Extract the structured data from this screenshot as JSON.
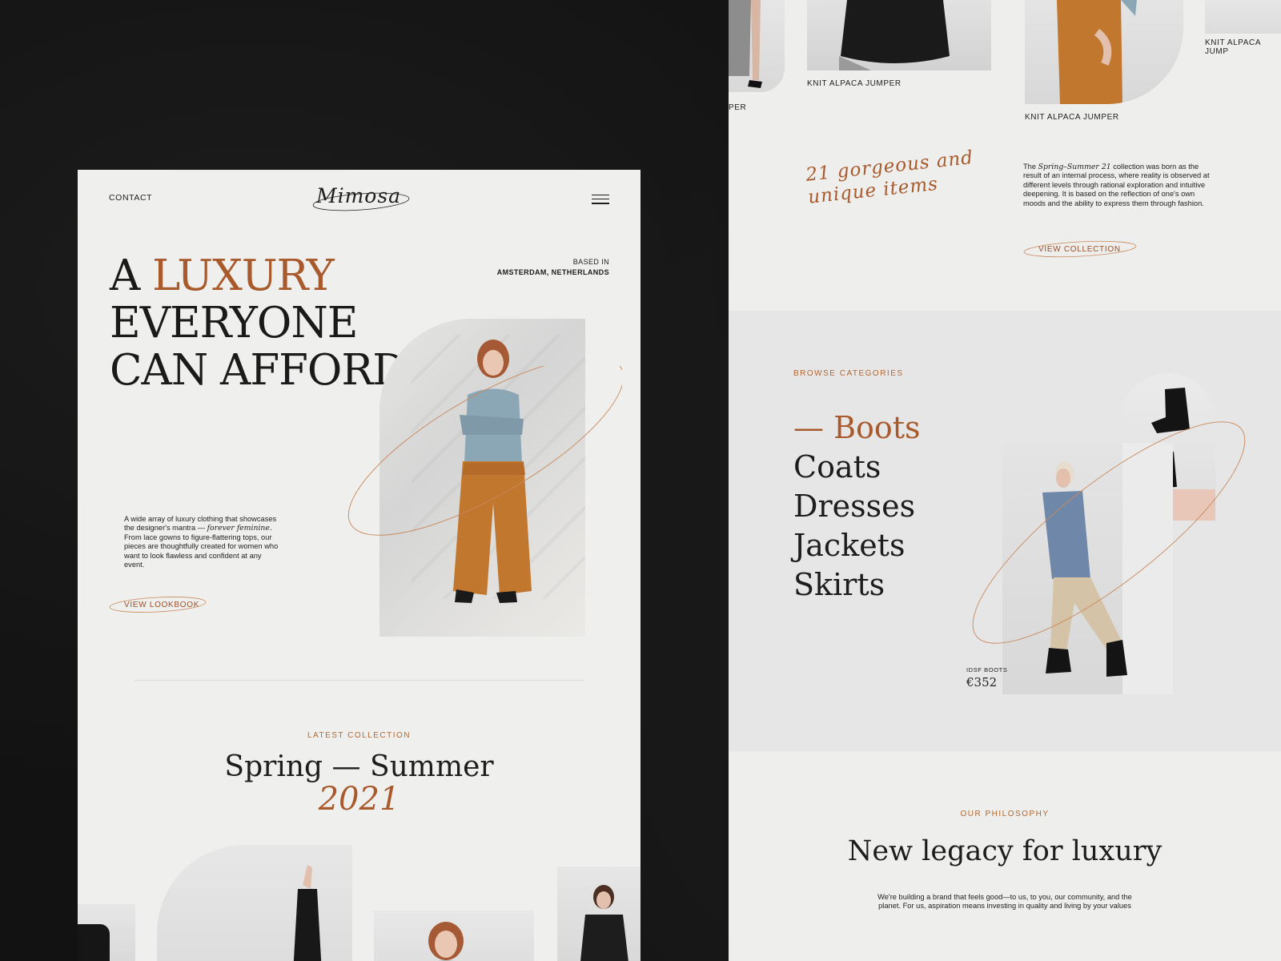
{
  "left_page": {
    "nav": {
      "contact": "CONTACT",
      "logo": "Mimosa"
    },
    "hero": {
      "title_line1_a": "A ",
      "title_line1_b": "LUXURY",
      "title_line2": "EVERYONE",
      "title_line3": "CAN AFFORD",
      "based_label": "BASED IN",
      "based_value": "AMSTERDAM, NETHERLANDS",
      "desc_part1": "A wide array of luxury clothing that showcases the designer's mantra —",
      "desc_italic": "forever feminine.",
      "desc_part2": " From lace gowns to figure-flattering tops, our pieces are thoughtfully created for women who want to look flawless and confident at any event.",
      "cta": "VIEW LOOKBOOK"
    },
    "latest": {
      "label": "LATEST COLLECTION",
      "title": "Spring — Summer",
      "year": "2021"
    }
  },
  "right_page": {
    "products": [
      {
        "label": "PER"
      },
      {
        "label": "KNIT ALPACA JUMPER"
      },
      {
        "label": "KNIT ALPACA JUMPER"
      },
      {
        "label": "KNIT ALPACA JUMP"
      }
    ],
    "collection": {
      "script": "21 gorgeous and unique items",
      "script_line1": "21 gorgeous and",
      "script_line2": "unique items",
      "desc_a": "The ",
      "desc_italic": "Spring–Summer 21",
      "desc_b": " collection was born as the result of an internal process, where reality is observed at different levels through rational exploration and intuitive deepening. It is based on the reflection of one's own moods and the ability to express them through fashion.",
      "cta": "VIEW COLLECTION"
    },
    "categories": {
      "label": "BROWSE CATEGORIES",
      "items": [
        "— Boots",
        "Coats",
        "Dresses",
        "Jackets",
        "Skirts"
      ],
      "active_index": 0,
      "product_name": "IDSF BOOTS",
      "product_price": "€352"
    },
    "philosophy": {
      "label": "OUR PHILOSOPHY",
      "title": "New legacy for luxury",
      "desc": "We're building a brand that feels good—to us, to you, our community, and the planet. For us, aspiration means investing in quality and living by your values"
    }
  },
  "colors": {
    "accent": "#a95a2c",
    "background": "#121212",
    "page": "#efefed"
  }
}
